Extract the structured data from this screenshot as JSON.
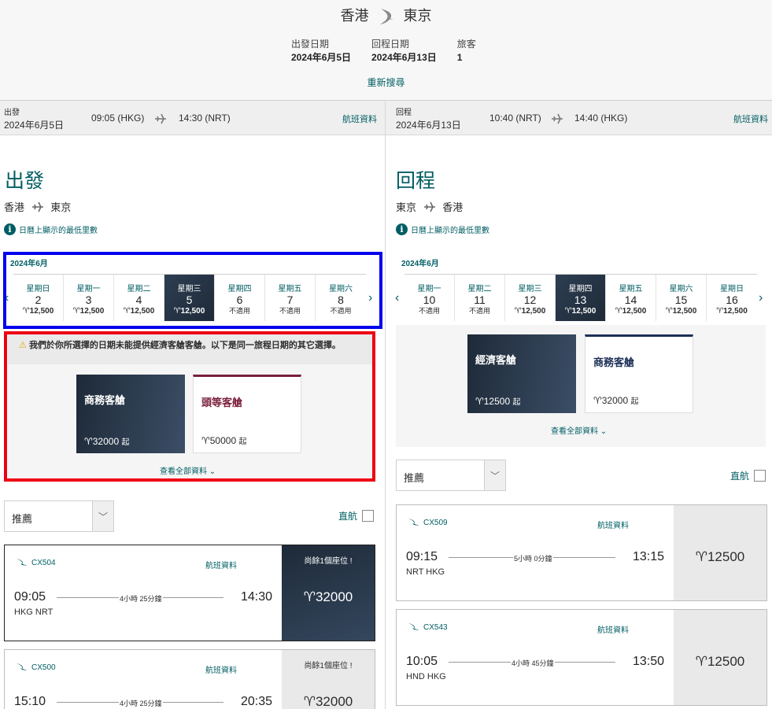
{
  "summary": {
    "origin": "香港",
    "destination": "東京",
    "depart_label": "出發日期",
    "depart_value": "2024年6月5日",
    "return_label": "回程日期",
    "return_value": "2024年6月13日",
    "pax_label": "旅客",
    "pax_value": "1",
    "research": "重新搜尋"
  },
  "legs": {
    "outbound": {
      "label": "出發",
      "date": "2024年6月5日",
      "dep_time": "09:05 (HKG)",
      "arr_time": "14:30 (NRT)",
      "info": "航班資料"
    },
    "inbound": {
      "label": "回程",
      "date": "2024年6月13日",
      "dep_time": "10:40 (NRT)",
      "arr_time": "14:40 (HKG)",
      "info": "航班資料"
    }
  },
  "outbound": {
    "title": "出發",
    "from": "香港",
    "to": "東京",
    "note": "日曆上顯示的最低里數",
    "month": "2024年6月",
    "days": [
      {
        "dow": "星期日",
        "d": "2",
        "p": "♈12,500"
      },
      {
        "dow": "星期一",
        "d": "3",
        "p": "♈12,500"
      },
      {
        "dow": "星期二",
        "d": "4",
        "p": "♈12,500"
      },
      {
        "dow": "星期三",
        "d": "5",
        "p": "♈12,500"
      },
      {
        "dow": "星期四",
        "d": "6",
        "p": "不適用"
      },
      {
        "dow": "星期五",
        "d": "7",
        "p": "不適用"
      },
      {
        "dow": "星期六",
        "d": "8",
        "p": "不適用"
      }
    ],
    "warning": "我們於你所選擇的日期未能提供經濟客艙客艙。以下是同一旅程日期的其它選擇。",
    "cabins": [
      {
        "name": "商務客艙",
        "price": "♈32000",
        "suffix": "起"
      },
      {
        "name": "頭等客艙",
        "price": "♈50000",
        "suffix": "起"
      }
    ],
    "see_all": "查看全部資料",
    "sort": "推薦",
    "nonstop": "直航",
    "flights": [
      {
        "no": "CX504",
        "info": "航班資料",
        "dep": "09:05",
        "arr": "14:30",
        "ports": "HKG  NRT",
        "dur": "4小時 25分鐘",
        "seats": "尚餘1個座位 !",
        "price": "♈32000"
      },
      {
        "no": "CX500",
        "info": "航班資料",
        "dep": "15:10",
        "arr": "20:35",
        "ports": "",
        "dur": "4小時 25分鐘",
        "seats": "尚餘1個座位 !",
        "price": "♈32000"
      }
    ]
  },
  "inbound": {
    "title": "回程",
    "from": "東京",
    "to": "香港",
    "note": "日曆上顯示的最低里數",
    "month": "2024年6月",
    "days": [
      {
        "dow": "星期一",
        "d": "10",
        "p": "不適用"
      },
      {
        "dow": "星期二",
        "d": "11",
        "p": "不適用"
      },
      {
        "dow": "星期三",
        "d": "12",
        "p": "♈12,500"
      },
      {
        "dow": "星期四",
        "d": "13",
        "p": "♈12,500"
      },
      {
        "dow": "星期五",
        "d": "14",
        "p": "♈12,500"
      },
      {
        "dow": "星期六",
        "d": "15",
        "p": "♈12,500"
      },
      {
        "dow": "星期日",
        "d": "16",
        "p": "♈12,500"
      }
    ],
    "cabins": [
      {
        "name": "經濟客艙",
        "price": "♈12500",
        "suffix": "起"
      },
      {
        "name": "商務客艙",
        "price": "♈32000",
        "suffix": "起"
      }
    ],
    "see_all": "查看全部資料",
    "sort": "推薦",
    "nonstop": "直航",
    "flights": [
      {
        "no": "CX509",
        "info": "航班資料",
        "dep": "09:15",
        "arr": "13:15",
        "ports": "NRT  HKG",
        "dur": "5小時 0分鐘",
        "price": "♈12500"
      },
      {
        "no": "CX543",
        "info": "航班資料",
        "dep": "10:05",
        "arr": "13:50",
        "ports": "HND  HKG",
        "dur": "4小時 45分鐘",
        "price": "♈12500"
      }
    ]
  },
  "icons": {
    "plane": "plane-icon",
    "info": "info-icon",
    "warning": "warning-icon",
    "logo": "cathay-logo-icon"
  }
}
